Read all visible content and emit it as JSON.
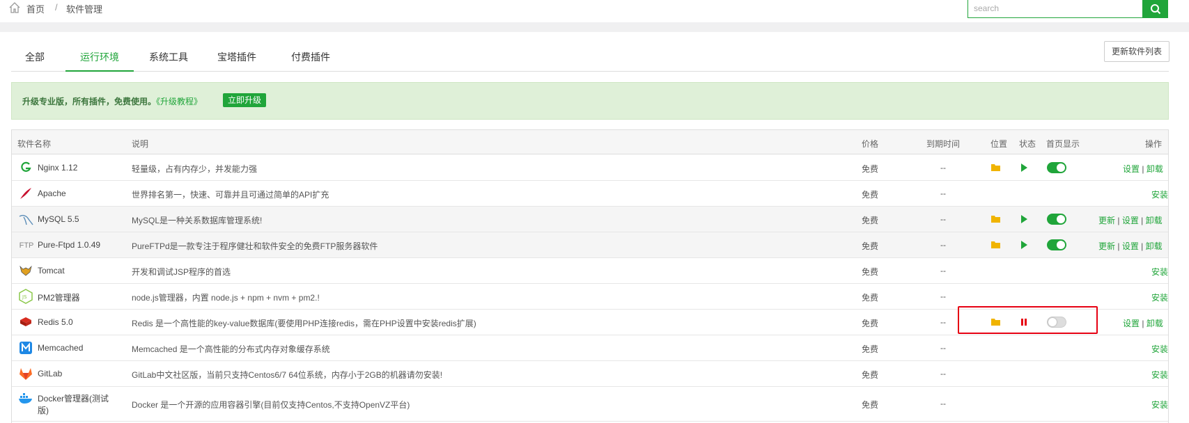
{
  "breadcrumb": {
    "home": "首页",
    "separator": "/",
    "current": "软件管理"
  },
  "search": {
    "placeholder": "search"
  },
  "tabs": [
    {
      "label": "全部",
      "active": false
    },
    {
      "label": "运行环境",
      "active": true
    },
    {
      "label": "系统工具",
      "active": false
    },
    {
      "label": "宝塔插件",
      "active": false
    },
    {
      "label": "付费插件",
      "active": false
    }
  ],
  "refresh_label": "更新软件列表",
  "banner": {
    "text": "升级专业版，所有插件，免费使用。",
    "link": "《升级教程》",
    "button": "立即升级"
  },
  "table": {
    "headers": {
      "name": "软件名称",
      "desc": "说明",
      "price": "价格",
      "expire": "到期时间",
      "location": "位置",
      "status": "状态",
      "homepage": "首页显示",
      "actions": "操作"
    },
    "rows": [
      {
        "icon": "nginx-icon",
        "name": "Nginx 1.12",
        "desc": "轻量级，占有内存少，并发能力强",
        "price": "免费",
        "expire": "--",
        "folder": true,
        "status": "running",
        "homepage": true,
        "actions": [
          "设置",
          "卸载"
        ]
      },
      {
        "icon": "apache-icon",
        "name": "Apache",
        "desc": "世界排名第一，快速、可靠并且可通过简单的API扩充",
        "price": "免费",
        "expire": "--",
        "folder": false,
        "status": "",
        "homepage": null,
        "actions": [
          "安装"
        ]
      },
      {
        "icon": "mysql-icon",
        "name": "MySQL 5.5",
        "desc": "MySQL是一种关系数据库管理系统!",
        "price": "免费",
        "expire": "--",
        "folder": true,
        "status": "running",
        "homepage": true,
        "actions": [
          "更新",
          "设置",
          "卸载"
        ]
      },
      {
        "icon": "ftp-icon",
        "name": "Pure-Ftpd 1.0.49",
        "desc": "PureFTPd是一款专注于程序健壮和软件安全的免费FTP服务器软件",
        "price": "免费",
        "expire": "--",
        "folder": true,
        "status": "running",
        "homepage": true,
        "actions": [
          "更新",
          "设置",
          "卸载"
        ]
      },
      {
        "icon": "tomcat-icon",
        "name": "Tomcat",
        "desc": "开发和调试JSP程序的首选",
        "price": "免费",
        "expire": "--",
        "folder": false,
        "status": "",
        "homepage": null,
        "actions": [
          "安装"
        ]
      },
      {
        "icon": "nodejs-icon",
        "name": "PM2管理器",
        "desc": "node.js管理器，内置 node.js + npm + nvm + pm2.!",
        "price": "免费",
        "expire": "--",
        "folder": false,
        "status": "",
        "homepage": null,
        "actions": [
          "安装"
        ]
      },
      {
        "icon": "redis-icon",
        "name": "Redis 5.0",
        "desc": "Redis 是一个高性能的key-value数据库(要使用PHP连接redis，需在PHP设置中安装redis扩展)",
        "price": "免费",
        "expire": "--",
        "folder": true,
        "status": "stopped",
        "homepage": false,
        "actions": [
          "设置",
          "卸载"
        ]
      },
      {
        "icon": "memcached-icon",
        "name": "Memcached",
        "desc": "Memcached 是一个高性能的分布式内存对象缓存系统",
        "price": "免费",
        "expire": "--",
        "folder": false,
        "status": "",
        "homepage": null,
        "actions": [
          "安装"
        ]
      },
      {
        "icon": "gitlab-icon",
        "name": "GitLab",
        "desc": "GitLab中文社区版，当前只支持Centos6/7 64位系统，内存小于2GB的机器请勿安装!",
        "price": "免费",
        "expire": "--",
        "folder": false,
        "status": "",
        "homepage": null,
        "actions": [
          "安装"
        ]
      },
      {
        "icon": "docker-icon",
        "name": "Docker管理器(测试版)",
        "desc": "Docker 是一个开源的应用容器引擎(目前仅支持Centos,不支持OpenVZ平台)",
        "price": "免费",
        "expire": "--",
        "folder": false,
        "status": "",
        "homepage": null,
        "actions": [
          "安装"
        ]
      }
    ]
  },
  "colors": {
    "accent": "#20a53a",
    "highlight_border": "#e60012",
    "folder": "#f0b400",
    "stop": "#e60012"
  }
}
